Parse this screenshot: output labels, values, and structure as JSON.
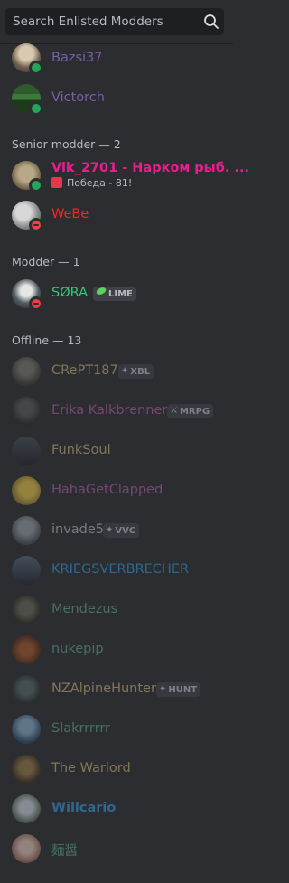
{
  "search": {
    "placeholder": "Search Enlisted Modders"
  },
  "sections": [
    {
      "label": "Senior modder — 2"
    },
    {
      "label": "Modder — 1"
    },
    {
      "label": "Offline — 13"
    }
  ],
  "members": [
    {
      "name": "Bazsi37",
      "color": "#7b5ea7",
      "status": "online"
    },
    {
      "name": "Victorch",
      "color": "#7b5ea7",
      "status": "online"
    },
    {
      "name": "Vik_2701 - Нарком рыб. ...",
      "color": "#e91e8c",
      "status": "online",
      "activity": "Победа - 81!"
    },
    {
      "name": "WeBe",
      "color": "#ed2a2a",
      "status": "dnd"
    },
    {
      "name": "SØRA",
      "color": "#2ecc71",
      "status": "dnd",
      "tag": "LIME"
    },
    {
      "name": "CRePT187",
      "color": "#c9b27a",
      "tag": "XBL"
    },
    {
      "name": "Erika Kalkbrenner",
      "color": "#b65ea8",
      "tag": "MRPG"
    },
    {
      "name": "FunkSoul",
      "color": "#c9b27a"
    },
    {
      "name": "HahaGetClapped",
      "color": "#b65ea8"
    },
    {
      "name": "invade5",
      "color": "#b5bac1",
      "tag": "VVC"
    },
    {
      "name": "KRIEGSVERBRECHER",
      "color": "#3498db"
    },
    {
      "name": "Mendezus",
      "color": "#5fa88a"
    },
    {
      "name": "nukepip",
      "color": "#5fa88a"
    },
    {
      "name": "NZAlpineHunter",
      "color": "#c9b27a",
      "tag": "HUNT"
    },
    {
      "name": "Slakrrrrrr",
      "color": "#5fa88a"
    },
    {
      "name": "The Warlord",
      "color": "#c9b27a"
    },
    {
      "name": "Willcario",
      "color": "#3498db"
    },
    {
      "name": "麺醤",
      "color": "#5fa88a"
    }
  ]
}
